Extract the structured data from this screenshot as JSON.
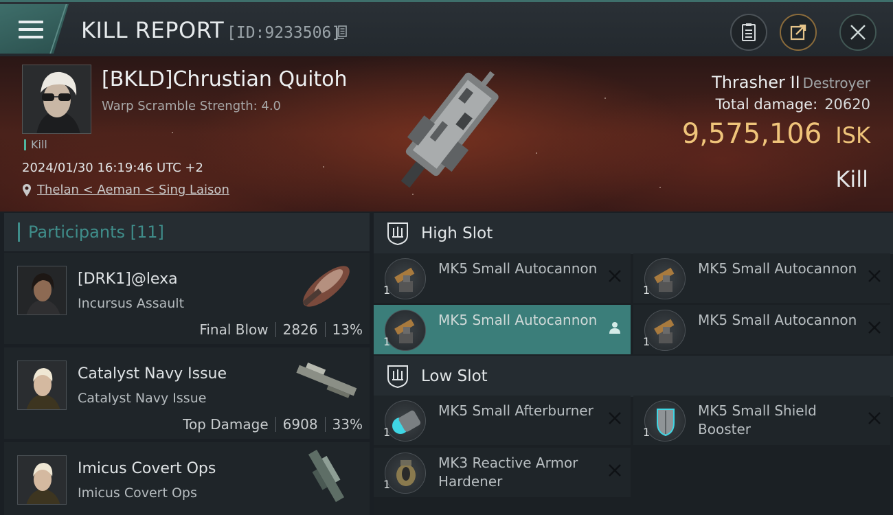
{
  "header": {
    "title": "KILL REPORT",
    "id_label": "[ID:9233506]"
  },
  "victim": {
    "name": "[BKLD]Chrustian Quitoh",
    "warp_scramble": "Warp Scramble Strength: 4.0",
    "tag": "Kill",
    "timestamp": "2024/01/30 16:19:46 UTC +2",
    "location": "Thelan < Aeman < Sing Laison",
    "ship_name": "Thrasher II",
    "ship_class": "Destroyer",
    "total_damage_label": "Total damage:",
    "total_damage": "20620",
    "isk_value": "9,575,106",
    "isk_unit": "ISK",
    "result": "Kill"
  },
  "participants": {
    "title": "Participants",
    "count": "[11]",
    "rows": [
      {
        "name": "[DRK1]@lexa",
        "ship": "Incursus Assault",
        "role": "Final Blow",
        "damage": "2826",
        "percent": "13%"
      },
      {
        "name": "Catalyst Navy Issue",
        "ship": "Catalyst Navy Issue",
        "role": "Top Damage",
        "damage": "6908",
        "percent": "33%"
      },
      {
        "name": "Imicus Covert Ops",
        "ship": "Imicus Covert Ops"
      }
    ]
  },
  "fitting": {
    "high_slot_title": "High Slot",
    "low_slot_title": "Low Slot",
    "high": [
      {
        "name": "MK5 Small Autocannon",
        "qty": "1"
      },
      {
        "name": "MK5 Small Autocannon",
        "qty": "1"
      },
      {
        "name": "MK5 Small Autocannon",
        "qty": "1"
      },
      {
        "name": "MK5 Small Autocannon",
        "qty": "1"
      }
    ],
    "low": [
      {
        "name": "MK5 Small Afterburner",
        "qty": "1"
      },
      {
        "name": "MK5 Small Shield Booster",
        "qty": "1"
      },
      {
        "name": "MK3 Reactive Armor Hardener",
        "qty": "1"
      }
    ]
  },
  "colors": {
    "accent": "#3f8d8a",
    "isk": "#efc47a",
    "active_module": "#3b7e7a"
  },
  "icons": [
    "menu-icon",
    "copy-icon",
    "report-icon",
    "share-icon",
    "close-icon",
    "location-pin-icon",
    "high-slot-icon",
    "low-slot-icon",
    "pilot-icon",
    "remove-x-icon"
  ]
}
